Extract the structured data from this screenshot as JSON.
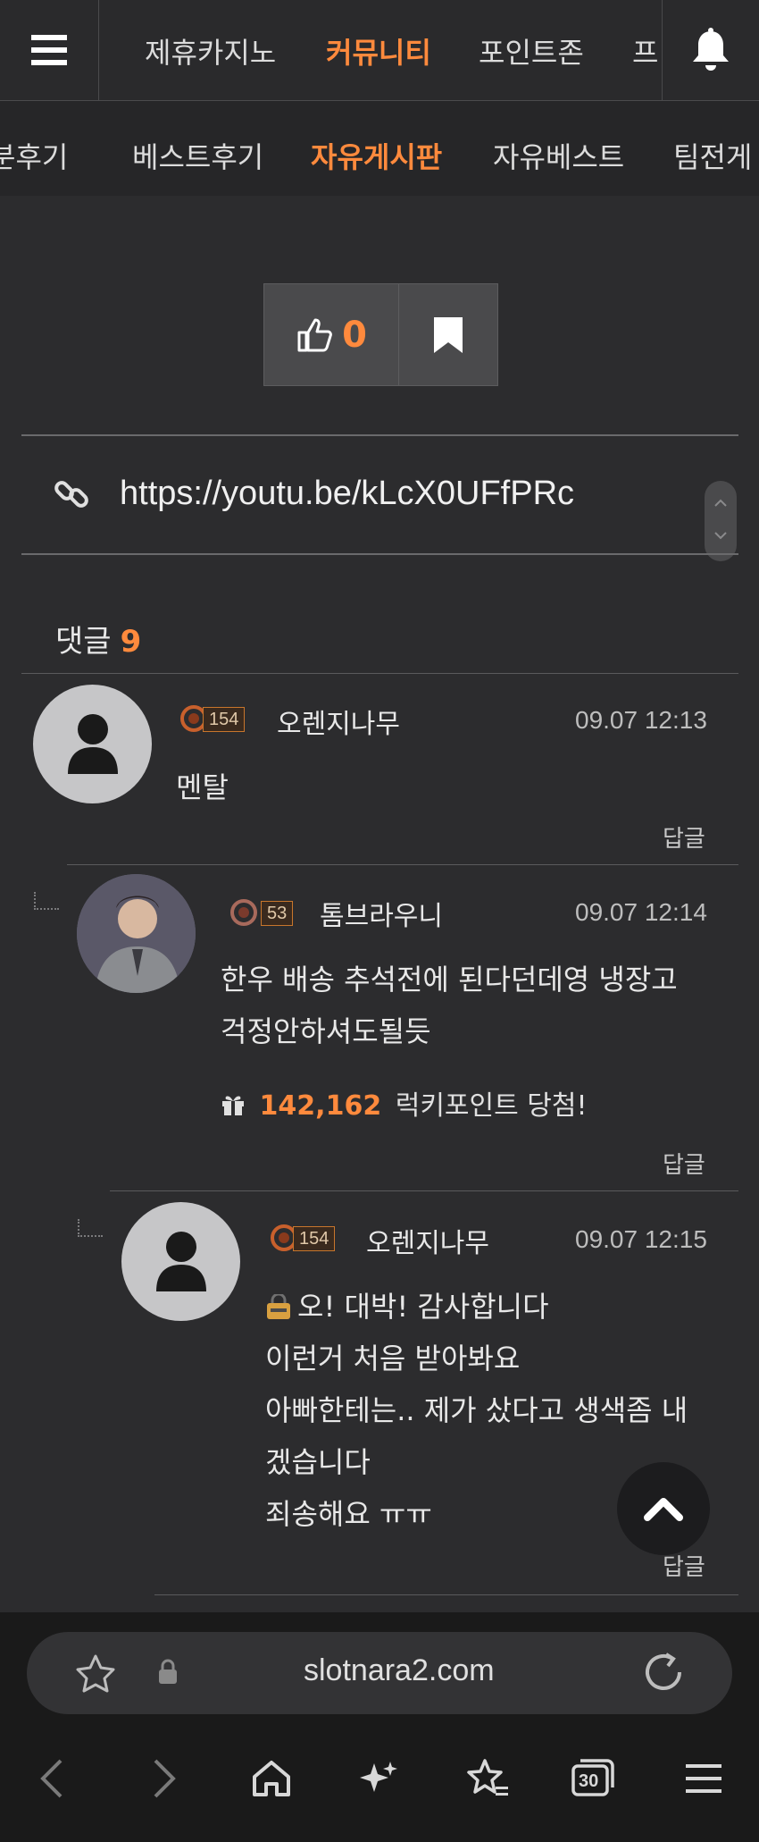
{
  "top_nav": {
    "tabs": [
      {
        "label": "제휴카지노"
      },
      {
        "label": "커뮤니티"
      },
      {
        "label": "포인트존"
      },
      {
        "label": "프"
      }
    ],
    "active_index": 1
  },
  "sub_nav": {
    "tabs": [
      {
        "label": "분후기"
      },
      {
        "label": "베스트후기"
      },
      {
        "label": "자유게시판"
      },
      {
        "label": "자유베스트"
      },
      {
        "label": "팀전게"
      }
    ],
    "active_index": 2
  },
  "post": {
    "like_count": "0",
    "link_url": "https://youtu.be/kLcX0UFfPRc"
  },
  "comments_header": {
    "label": "댓글",
    "count": "9"
  },
  "comments": [
    {
      "author": "오렌지나무",
      "level": "154",
      "time": "09.07 12:13",
      "lines": [
        "멘탈"
      ],
      "reply_label": "답글"
    },
    {
      "author": "톰브라우니",
      "level": "53",
      "time": "09.07 12:14",
      "lines": [
        "한우 배송 추석전에 된다던데영 냉장고",
        "걱정안하셔도될듯"
      ],
      "prize_amount": "142,162",
      "prize_text": "럭키포인트 당첨!",
      "reply_label": "답글"
    },
    {
      "author": "오렌지나무",
      "level": "154",
      "time": "09.07 12:15",
      "lines": [
        "오! 대박! 감사합니다",
        "이런거 처음 받아봐요",
        "아빠한테는.. 제가 샀다고 생색좀 내",
        "겠습니다",
        "죄송해요 ㅠㅠ"
      ],
      "reply_label": "답글"
    }
  ],
  "browser": {
    "url": "slotnara2.com",
    "tab_count": "30"
  },
  "colors": {
    "accent": "#ff8a3d",
    "background": "#2c2c2e"
  }
}
